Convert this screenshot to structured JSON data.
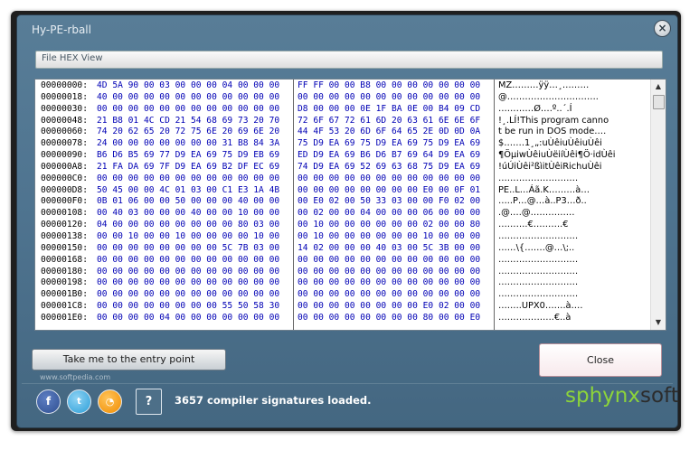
{
  "window": {
    "title": "Hy-PE-rball",
    "close_glyph": "×"
  },
  "section": {
    "label": "File HEX View"
  },
  "hex_view": {
    "addresses": [
      "00000000:",
      "00000018:",
      "00000030:",
      "00000048:",
      "00000060:",
      "00000078:",
      "00000090:",
      "000000A8:",
      "000000C0:",
      "000000D8:",
      "000000F0:",
      "00000108:",
      "00000120:",
      "00000138:",
      "00000150:",
      "00000168:",
      "00000180:",
      "00000198:",
      "000001B0:",
      "000001C8:",
      "000001E0:"
    ],
    "bytes_left": [
      "4D 5A 90 00 03 00 00 00 04 00 00 00",
      "40 00 00 00 00 00 00 00 00 00 00 00",
      "00 00 00 00 00 00 00 00 00 00 00 00",
      "21 B8 01 4C CD 21 54 68 69 73 20 70",
      "74 20 62 65 20 72 75 6E 20 69 6E 20",
      "24 00 00 00 00 00 00 00 31 B8 84 3A",
      "B6 D6 B5 69 77 D9 EA 69 75 D9 EB 69",
      "21 FA DA 69 7F D9 EA 69 B2 DF EC 69",
      "00 00 00 00 00 00 00 00 00 00 00 00",
      "50 45 00 00 4C 01 03 00 C1 E3 1A 4B",
      "0B 01 06 00 00 50 00 00 00 40 00 00",
      "00 40 03 00 00 00 40 00 00 10 00 00",
      "04 00 00 00 00 00 00 00 00 80 03 00",
      "00 00 10 00 00 10 00 00 00 00 10 00",
      "00 00 00 00 00 00 00 00 5C 7B 03 00",
      "00 00 00 00 00 00 00 00 00 00 00 00",
      "00 00 00 00 00 00 00 00 00 00 00 00",
      "00 00 00 00 00 00 00 00 00 00 00 00",
      "00 00 00 00 00 00 00 00 00 00 00 00",
      "00 00 00 00 00 00 00 00 55 50 58 30",
      "00 00 00 00 04 00 00 00 00 00 00 00"
    ],
    "bytes_right": [
      "FF FF 00 00 B8 00 00 00 00 00 00 00",
      "00 00 00 00 00 00 00 00 00 00 00 00",
      "D8 00 00 00 0E 1F BA 0E 00 B4 09 CD",
      "72 6F 67 72 61 6D 20 63 61 6E 6E 6F",
      "44 4F 53 20 6D 6F 64 65 2E 0D 0D 0A",
      "75 D9 EA 69 75 D9 EA 69 75 D9 EA 69",
      "ED D9 EA 69 B6 D6 B7 69 64 D9 EA 69",
      "74 D9 EA 69 52 69 63 68 75 D9 EA 69",
      "00 00 00 00 00 00 00 00 00 00 00 00",
      "00 00 00 00 00 00 00 00 E0 00 0F 01",
      "00 E0 02 00 50 33 03 00 00 F0 02 00",
      "00 02 00 00 04 00 00 00 06 00 00 00",
      "00 10 00 00 00 00 00 00 02 00 00 80",
      "00 10 00 00 00 00 00 00 10 00 00 00",
      "14 02 00 00 00 40 03 00 5C 3B 00 00",
      "00 00 00 00 00 00 00 00 00 00 00 00",
      "00 00 00 00 00 00 00 00 00 00 00 00",
      "00 00 00 00 00 00 00 00 00 00 00 00",
      "00 00 00 00 00 00 00 00 00 00 00 00",
      "00 00 00 00 00 00 00 00 E0 02 00 00",
      "00 00 00 00 00 00 00 00 80 00 00 E0"
    ],
    "ascii": [
      "MZ………ÿÿ…¸………",
      "@………………………….",
      "…………Ø….º..´.Í",
      "!¸.LÍ!This program canno",
      "t be run in DOS mode….",
      "$…….1¸„:uÙêiuÙêiuÙêi",
      "¶ÖµiwÙêiuÙëiíÙêi¶Ö·idÙêi",
      "!úÚiÙêi²ßìitÙêiRichuÙêi",
      "………………………",
      "PE..L…Áã.K………à…",
      "…..P…@…à..P3…ð..",
      ".@….@……………",
      "……….€……….€",
      "………………………",
      "……\\{…….@…\\;..",
      "………………………",
      "………………………",
      "………………………",
      "………………………",
      "……..UPX0…….à….",
      "……………….€..à"
    ]
  },
  "buttons": {
    "entry_point": "Take me to the entry point",
    "close": "Close",
    "help": "?"
  },
  "social": {
    "facebook_glyph": "f",
    "twitter_glyph": "t",
    "rss_glyph": "◔"
  },
  "status": {
    "text": "3657 compiler signatures loaded."
  },
  "brand": {
    "part1": "sphynx",
    "part2": "soft"
  },
  "watermark": {
    "text": "www.softpedia.com"
  },
  "scrollbar": {
    "up": "▲",
    "down": "▼"
  }
}
